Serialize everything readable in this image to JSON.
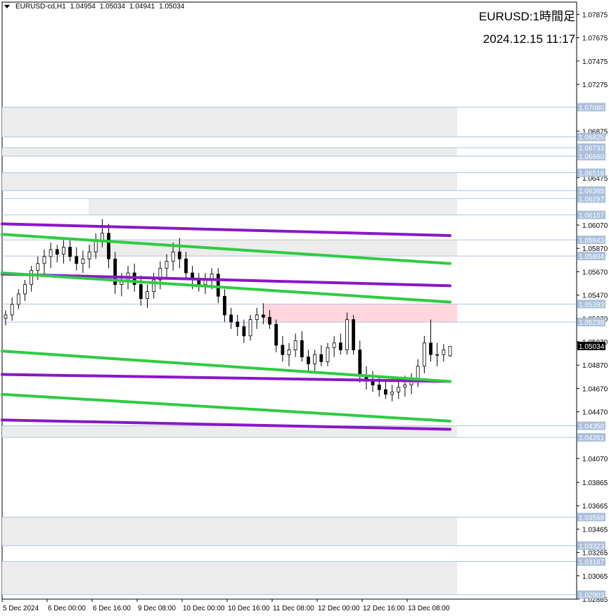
{
  "header": {
    "symbol": "EURUSD-cd,H1",
    "ohlc": [
      "1.04954",
      "1.05034",
      "1.04941",
      "1.05034"
    ]
  },
  "overlay": {
    "title": "EURUSD:1時間足",
    "date": "2024.12.15 11:17"
  },
  "colors": {
    "zone_gray": "#ececec",
    "zone_pink": "#ffd6de",
    "level_line": "#b0c4de",
    "badge": "#a9bfdc",
    "green_channel": "#2ecc40",
    "purple_channel": "#8a16c8",
    "candle": "#000000",
    "current_price_badge": "#000000"
  },
  "chart_data": {
    "type": "candlestick",
    "y_range": [
      1.02865,
      1.0798
    ],
    "y_ticks": [
      "1.07875",
      "1.07675",
      "1.07475",
      "1.07275",
      "1.06875",
      "1.06475",
      "1.06070",
      "1.05870",
      "1.05670",
      "1.05470",
      "1.05270",
      "1.05070",
      "1.04870",
      "1.04670",
      "1.04470",
      "1.04070",
      "1.03865",
      "1.03665",
      "1.03465",
      "1.03265",
      "1.03065",
      "1.02865"
    ],
    "x_ticks": [
      "5 Dec 2024",
      "6 Dec 00:00",
      "6 Dec 16:00",
      "9 Dec 08:00",
      "10 Dec 00:00",
      "10 Dec 16:00",
      "11 Dec 08:00",
      "12 Dec 00:00",
      "12 Dec 16:00",
      "13 Dec 08:00"
    ],
    "levels": [
      "1.07080",
      "1.06825",
      "1.06733",
      "1.06660",
      "1.06518",
      "1.06365",
      "1.06297",
      "1.06157",
      "1.05943",
      "1.05804",
      "1.05393",
      "1.05238",
      "1.04350",
      "1.04251",
      "1.03568",
      "1.03323",
      "1.03187",
      "1.02903"
    ],
    "current_price": "1.05034",
    "zones": [
      {
        "kind": "gray",
        "top": 1.0708,
        "bottom": 1.06825,
        "start": 0.0
      },
      {
        "kind": "gray",
        "top": 1.06733,
        "bottom": 1.0666,
        "start": 0.0
      },
      {
        "kind": "gray",
        "top": 1.06518,
        "bottom": 1.06365,
        "start": 0.0
      },
      {
        "kind": "gray",
        "top": 1.06297,
        "bottom": 1.06157,
        "start": 0.19
      },
      {
        "kind": "gray",
        "top": 1.05943,
        "bottom": 1.05804,
        "start": 0.19
      },
      {
        "kind": "pink",
        "top": 1.05393,
        "bottom": 1.05238,
        "start": 0.575
      },
      {
        "kind": "gray",
        "top": 1.0435,
        "bottom": 1.04251,
        "start": 0.0
      },
      {
        "kind": "gray",
        "top": 1.03568,
        "bottom": 1.03323,
        "start": 0.0
      },
      {
        "kind": "gray",
        "top": 1.03187,
        "bottom": 1.02903,
        "start": 0.0
      }
    ],
    "channels": [
      {
        "color": "purple",
        "x": [
          0.0,
          1.0
        ],
        "y": [
          1.0608,
          1.0598
        ]
      },
      {
        "color": "purple",
        "x": [
          0.0,
          1.0
        ],
        "y": [
          1.0565,
          1.0555
        ]
      },
      {
        "color": "purple",
        "x": [
          0.0,
          1.0
        ],
        "y": [
          1.0479,
          1.0473
        ]
      },
      {
        "color": "purple",
        "x": [
          0.0,
          1.0
        ],
        "y": [
          1.044,
          1.0432
        ]
      },
      {
        "color": "green",
        "x": [
          0.0,
          1.0
        ],
        "y": [
          1.0599,
          1.0574
        ]
      },
      {
        "color": "green",
        "x": [
          0.0,
          1.0
        ],
        "y": [
          1.0566,
          1.0541
        ]
      },
      {
        "color": "green",
        "x": [
          0.0,
          1.0
        ],
        "y": [
          1.0499,
          1.0473
        ]
      },
      {
        "color": "green",
        "x": [
          0.0,
          1.0
        ],
        "y": [
          1.0462,
          1.0439
        ]
      }
    ],
    "candles": [
      [
        1.0527,
        1.0534,
        1.0521,
        1.053
      ],
      [
        1.053,
        1.0545,
        1.0525,
        1.0539
      ],
      [
        1.0539,
        1.0552,
        1.0535,
        1.0548
      ],
      [
        1.0548,
        1.056,
        1.0542,
        1.0556
      ],
      [
        1.0556,
        1.0572,
        1.055,
        1.0568
      ],
      [
        1.0568,
        1.058,
        1.056,
        1.0574
      ],
      [
        1.0574,
        1.0586,
        1.0565,
        1.058
      ],
      [
        1.058,
        1.0592,
        1.057,
        1.0586
      ],
      [
        1.0586,
        1.059,
        1.0575,
        1.0582
      ],
      [
        1.0582,
        1.0594,
        1.0574,
        1.0588
      ],
      [
        1.0588,
        1.0596,
        1.0576,
        1.058
      ],
      [
        1.058,
        1.0588,
        1.0568,
        1.0574
      ],
      [
        1.0574,
        1.0585,
        1.0566,
        1.0578
      ],
      [
        1.0578,
        1.059,
        1.057,
        1.0584
      ],
      [
        1.0584,
        1.06,
        1.0578,
        1.0594
      ],
      [
        1.0594,
        1.0612,
        1.0588,
        1.06
      ],
      [
        1.06,
        1.0608,
        1.057,
        1.0578
      ],
      [
        1.0578,
        1.0584,
        1.0548,
        1.0556
      ],
      [
        1.0556,
        1.0566,
        1.0546,
        1.056
      ],
      [
        1.056,
        1.0572,
        1.0552,
        1.0566
      ],
      [
        1.0566,
        1.0574,
        1.055,
        1.0556
      ],
      [
        1.0556,
        1.0564,
        1.0538,
        1.0544
      ],
      [
        1.0544,
        1.0556,
        1.0536,
        1.055
      ],
      [
        1.055,
        1.0566,
        1.0544,
        1.056
      ],
      [
        1.056,
        1.0576,
        1.0552,
        1.057
      ],
      [
        1.057,
        1.0582,
        1.0562,
        1.0576
      ],
      [
        1.0576,
        1.0592,
        1.0568,
        1.0584
      ],
      [
        1.0584,
        1.0596,
        1.057,
        1.0578
      ],
      [
        1.0578,
        1.0584,
        1.056,
        1.0566
      ],
      [
        1.0566,
        1.0572,
        1.0552,
        1.056
      ],
      [
        1.056,
        1.0566,
        1.055,
        1.0556
      ],
      [
        1.0556,
        1.0566,
        1.0548,
        1.056
      ],
      [
        1.056,
        1.057,
        1.0552,
        1.0565
      ],
      [
        1.0565,
        1.057,
        1.054,
        1.0546
      ],
      [
        1.0546,
        1.0552,
        1.0524,
        1.053
      ],
      [
        1.053,
        1.0536,
        1.0518,
        1.0524
      ],
      [
        1.0524,
        1.053,
        1.0512,
        1.052
      ],
      [
        1.052,
        1.0526,
        1.0506,
        1.0512
      ],
      [
        1.0512,
        1.053,
        1.0508,
        1.0526
      ],
      [
        1.0526,
        1.0536,
        1.0518,
        1.053
      ],
      [
        1.053,
        1.054,
        1.0522,
        1.0528
      ],
      [
        1.0528,
        1.0534,
        1.0518,
        1.0522
      ],
      [
        1.0522,
        1.0526,
        1.0498,
        1.0504
      ],
      [
        1.0504,
        1.0512,
        1.049,
        1.0496
      ],
      [
        1.0496,
        1.0506,
        1.0486,
        1.05
      ],
      [
        1.05,
        1.0514,
        1.0494,
        1.0508
      ],
      [
        1.0508,
        1.0516,
        1.049,
        1.0494
      ],
      [
        1.0494,
        1.05,
        1.0482,
        1.0488
      ],
      [
        1.0488,
        1.05,
        1.0482,
        1.0496
      ],
      [
        1.0496,
        1.0504,
        1.0486,
        1.049
      ],
      [
        1.049,
        1.0506,
        1.0486,
        1.0502
      ],
      [
        1.0502,
        1.0512,
        1.0494,
        1.0506
      ],
      [
        1.0506,
        1.0514,
        1.0496,
        1.05
      ],
      [
        1.05,
        1.0532,
        1.0496,
        1.0526
      ],
      [
        1.0526,
        1.053,
        1.0496,
        1.05
      ],
      [
        1.05,
        1.0508,
        1.0472,
        1.0478
      ],
      [
        1.0478,
        1.0486,
        1.0466,
        1.0474
      ],
      [
        1.0474,
        1.0482,
        1.0464,
        1.047
      ],
      [
        1.047,
        1.0478,
        1.046,
        1.0466
      ],
      [
        1.0466,
        1.0474,
        1.0458,
        1.0462
      ],
      [
        1.0462,
        1.047,
        1.0456,
        1.0464
      ],
      [
        1.0464,
        1.0474,
        1.0458,
        1.0468
      ],
      [
        1.0468,
        1.0478,
        1.046,
        1.047
      ],
      [
        1.047,
        1.048,
        1.0462,
        1.0474
      ],
      [
        1.0474,
        1.0492,
        1.0468,
        1.0486
      ],
      [
        1.0486,
        1.0512,
        1.048,
        1.0506
      ],
      [
        1.0506,
        1.0526,
        1.049,
        1.0496
      ],
      [
        1.0496,
        1.0506,
        1.0486,
        1.0496
      ],
      [
        1.0496,
        1.0505,
        1.049,
        1.05
      ],
      [
        1.0495,
        1.0503,
        1.0494,
        1.0503
      ]
    ]
  }
}
